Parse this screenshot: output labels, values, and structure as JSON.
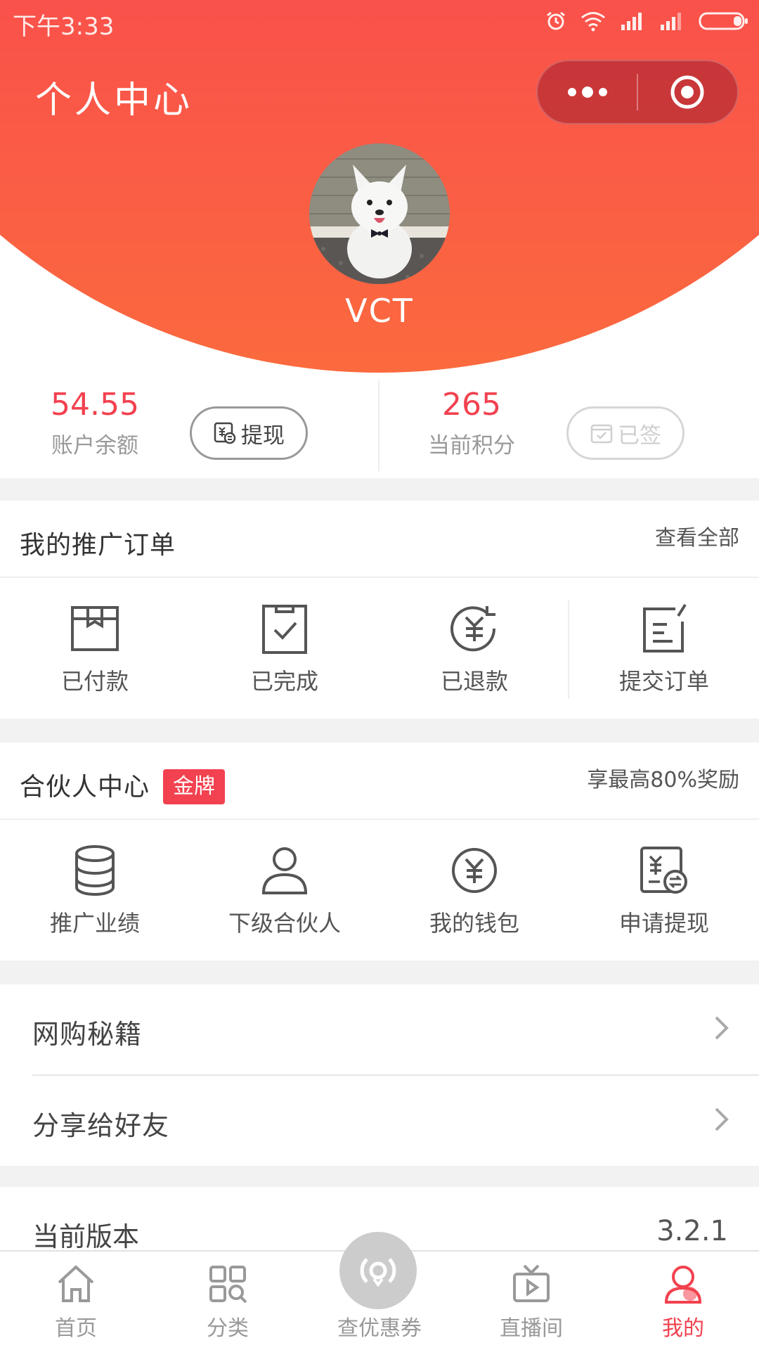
{
  "status_bar": {
    "time": "下午3:33",
    "icons": [
      "alarm-icon",
      "wifi-icon",
      "signal-icon",
      "signal-icon",
      "battery-icon"
    ]
  },
  "header": {
    "title": "个人中心",
    "capsule": {
      "more_icon": "more-dots-icon",
      "close_icon": "target-circle-icon"
    },
    "avatar_alt": "dog-avatar",
    "username": "VCT"
  },
  "colors": {
    "primary_red": "#f2414f",
    "header_gradient_top": "#f84356",
    "header_gradient_bottom": "#fb6a3e",
    "disabled": "#d6d6d6"
  },
  "stats": {
    "balance": {
      "value": "54.55",
      "label": "账户余额",
      "button": "提现"
    },
    "points": {
      "value": "265",
      "label": "当前积分",
      "button": "已签"
    }
  },
  "orders": {
    "title": "我的推广订单",
    "link": "查看全部",
    "items": [
      {
        "label": "已付款",
        "icon": "box-icon"
      },
      {
        "label": "已完成",
        "icon": "clipboard-check-icon"
      },
      {
        "label": "已退款",
        "icon": "refund-icon"
      },
      {
        "label": "提交订单",
        "icon": "edit-note-icon"
      }
    ]
  },
  "partner": {
    "title": "合伙人中心",
    "badge": "金牌",
    "link": "享最高80%奖励",
    "items": [
      {
        "label": "推广业绩",
        "icon": "coins-stack-icon"
      },
      {
        "label": "下级合伙人",
        "icon": "user-icon"
      },
      {
        "label": "我的钱包",
        "icon": "yuan-circle-icon"
      },
      {
        "label": "申请提现",
        "icon": "withdraw-icon"
      }
    ]
  },
  "menu": {
    "items": [
      {
        "label": "网购秘籍"
      },
      {
        "label": "分享给好友"
      }
    ]
  },
  "version": {
    "label": "当前版本",
    "value": "3.2.1"
  },
  "tabbar": {
    "items": [
      {
        "label": "首页",
        "icon": "home-icon"
      },
      {
        "label": "分类",
        "icon": "category-icon"
      },
      {
        "label": "查优惠券",
        "icon": "broadcast-icon"
      },
      {
        "label": "直播间",
        "icon": "tv-play-icon"
      },
      {
        "label": "我的",
        "icon": "profile-icon",
        "active": true
      }
    ]
  }
}
